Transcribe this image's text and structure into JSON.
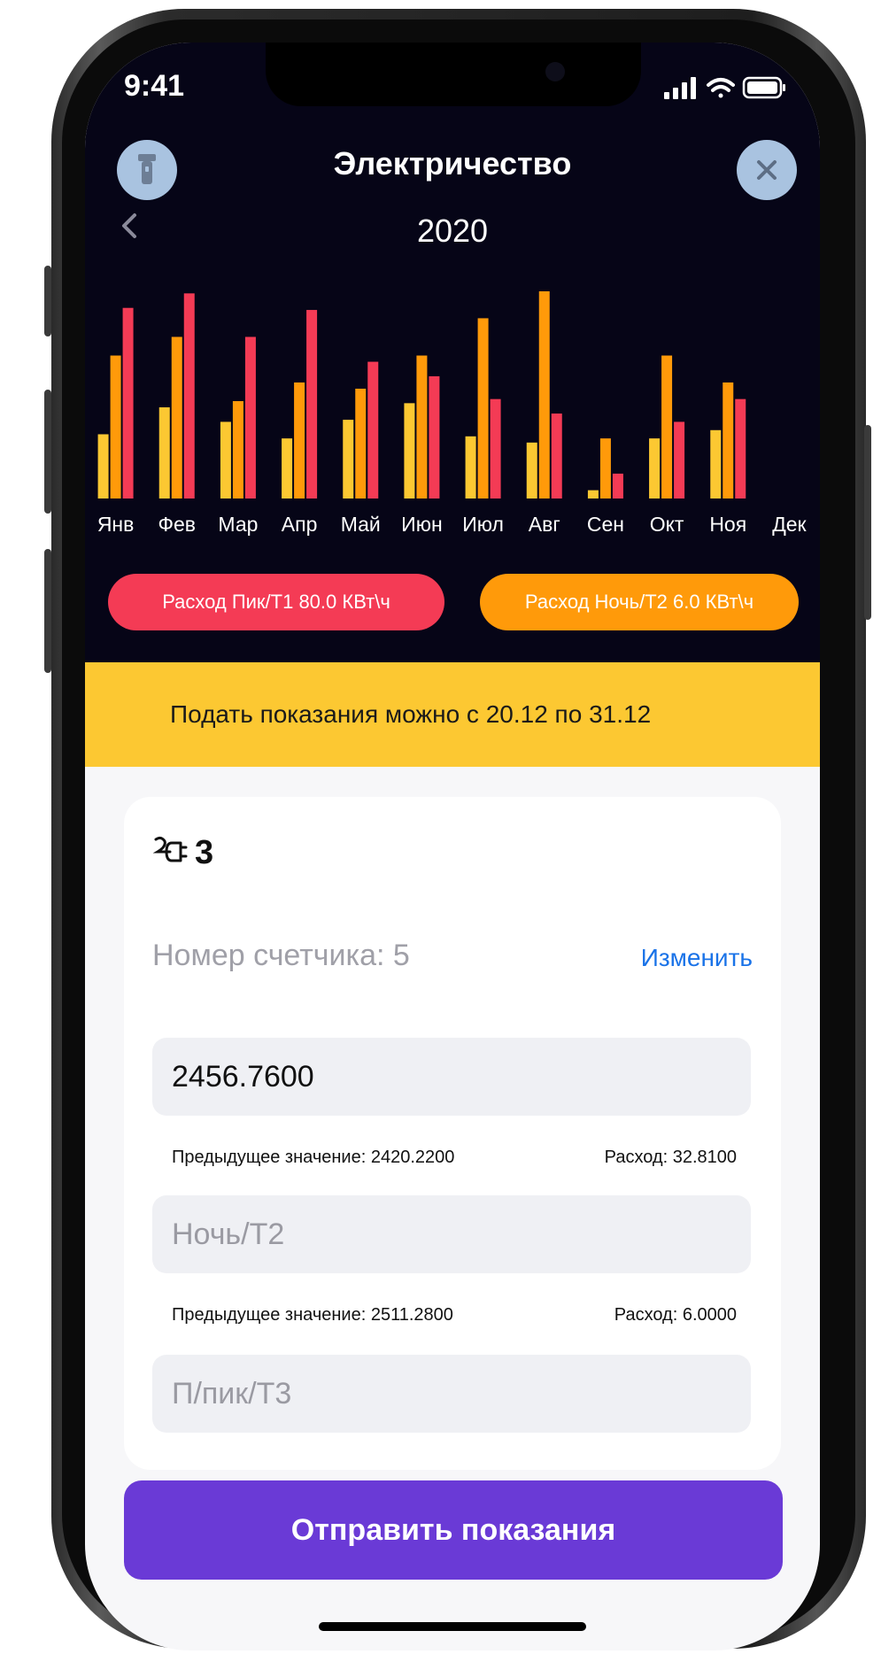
{
  "status": {
    "time": "9:41"
  },
  "header": {
    "title": "Электричество",
    "year": "2020",
    "back_icon": "chevron-left-icon",
    "left_icon": "flashlight-icon",
    "close_icon": "close-icon"
  },
  "chart_data": {
    "type": "bar",
    "categories": [
      "Янв",
      "Фев",
      "Мар",
      "Апр",
      "Май",
      "Июн",
      "Июл",
      "Авг",
      "Сен",
      "Окт",
      "Ноя",
      "Дек"
    ],
    "series": [
      {
        "color": "#fcc832",
        "values": [
          31,
          44,
          37,
          29,
          38,
          46,
          30,
          27,
          4,
          29,
          33,
          0
        ]
      },
      {
        "color": "#ff9a0a",
        "values": [
          69,
          78,
          47,
          56,
          53,
          69,
          87,
          100,
          29,
          69,
          56,
          0
        ]
      },
      {
        "color": "#f43b55",
        "values": [
          92,
          99,
          78,
          91,
          66,
          59,
          48,
          41,
          12,
          37,
          48,
          0
        ]
      }
    ],
    "ylim": [
      0,
      100
    ]
  },
  "pills": {
    "peak": "Расход Пик/T1 80.0 КВт\\ч",
    "night": "Расход Ночь/T2 6.0 КВт\\ч"
  },
  "banner": {
    "text": "Подать показания можно с 20.12 по 31.12"
  },
  "card": {
    "meter_icon": "plug-icon",
    "meter_name": "3",
    "meter_number": "Номер счетчика: 5",
    "change": "Изменить",
    "t1_value": "2456.7600",
    "t1_prev": "Предыдущее значение: 2420.2200",
    "t1_consumption": "Расход: 32.8100",
    "t2_placeholder": "Ночь/T2",
    "t2_prev": "Предыдущее значение: 2511.2800",
    "t2_consumption": "Расход: 6.0000",
    "t3_placeholder": "П/пик/Т3"
  },
  "submit": {
    "label": "Отправить показания"
  }
}
